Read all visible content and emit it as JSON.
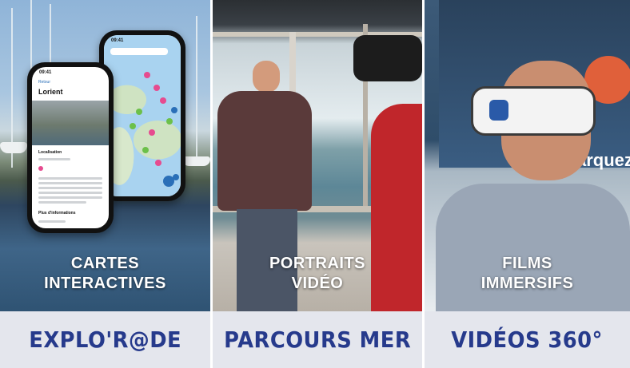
{
  "panels": [
    {
      "caption_line1": "CARTES",
      "caption_line2": "INTERACTIVES",
      "title": "EXPLO'R@DE",
      "phone_front": {
        "time": "09:41",
        "back": "Retour",
        "place": "Lorient",
        "section": "Localisation",
        "more": "Plus d'informations"
      },
      "phone_back": {
        "time": "09:41"
      }
    },
    {
      "caption_line1": "PORTRAITS",
      "caption_line2": "VIDÉO",
      "title": "PARCOURS MER"
    },
    {
      "caption_line1": "FILMS",
      "caption_line2": "IMMERSIFS",
      "title": "VIDÉOS 360°",
      "banner_text": "arquez"
    }
  ],
  "colors": {
    "title_blue": "#263a8c",
    "caption_white": "#ffffff",
    "band_bg": "#e2e4ec"
  }
}
